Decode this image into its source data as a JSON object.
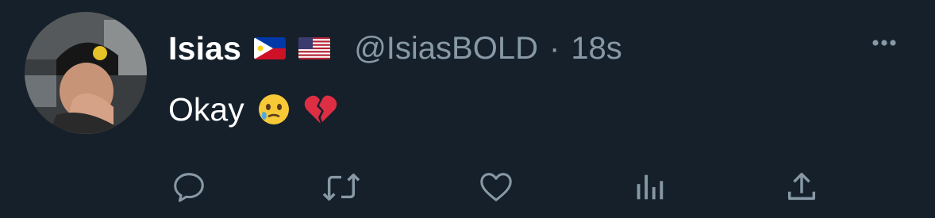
{
  "tweet": {
    "display_name": "Isias",
    "handle": "@IsiasBOLD",
    "separator": "·",
    "time": "18s",
    "text": "Okay",
    "flags": [
      "philippines-flag",
      "usa-flag"
    ],
    "emojis": [
      "face-holding-back-tears-emoji",
      "broken-heart-emoji"
    ]
  },
  "actions": [
    "reply",
    "retweet",
    "like",
    "analytics",
    "share"
  ],
  "colors": {
    "background": "#15202b",
    "text": "#ffffff",
    "secondary": "#8899a6"
  }
}
